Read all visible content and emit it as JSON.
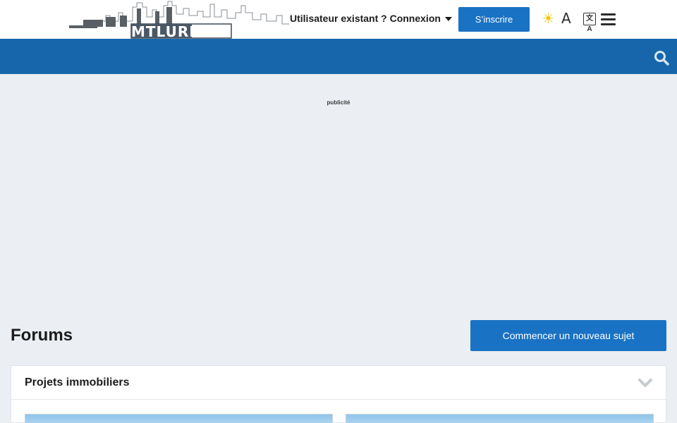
{
  "header": {
    "logo_text": "MTLURB",
    "signin_label": "Utilisateur existant ? Connexion",
    "register_label": "S’inscrire",
    "sun_glyph": "☀",
    "font_glyph": "A",
    "translate_glyph": "文A",
    "accent_color": "#1a72c4"
  },
  "navbar": {
    "background": "#1766ab"
  },
  "ad": {
    "label": "publicité"
  },
  "main": {
    "page_title": "Forums",
    "new_topic_label": "Commencer un nouveau sujet",
    "categories": [
      {
        "title": "Projets immobiliers"
      }
    ]
  }
}
